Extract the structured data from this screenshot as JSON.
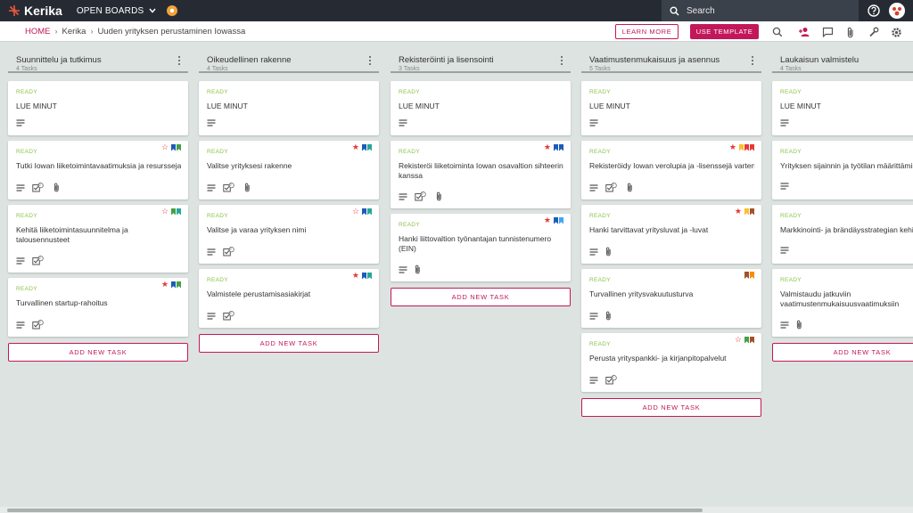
{
  "app": {
    "logo_text": "Kerika",
    "open_boards_label": "OPEN BOARDS",
    "search_placeholder": "Search"
  },
  "breadcrumb": {
    "home": "HOME",
    "org": "Kerika",
    "board": "Uuden yrityksen perustaminen Iowassa"
  },
  "toolbar": {
    "learn_more": "LEARN MORE",
    "use_template": "USE TEMPLATE",
    "icons": [
      "search-icon",
      "add-person-icon",
      "chat-icon",
      "attachment-icon",
      "tools-icon",
      "settings-icon"
    ]
  },
  "colors": {
    "accent": "#c2185b",
    "ready": "#8bc34a",
    "topbar": "#262b33",
    "background": "#dde3e1",
    "star_red": "#e53935",
    "star_outline": "#e53935",
    "bm_blue": "#1e5bb8",
    "bm_green": "#43a047",
    "bm_teal": "#26a69a",
    "bm_lightblue": "#42a5f5",
    "bm_yellow": "#fbc02d",
    "bm_orange": "#fb8c00",
    "bm_red": "#e53935",
    "bm_brown": "#a0522d"
  },
  "add_task_label": "ADD NEW TASK",
  "columns": [
    {
      "title": "Suunnittelu ja tutkimus",
      "count": "4 Tasks",
      "cards": [
        {
          "status": "READY",
          "title": "LUE MINUT",
          "flags": null,
          "icons": [
            "description"
          ]
        },
        {
          "status": "READY",
          "title": "Tutki Iowan liiketoimintavaatimuksia ja resursseja",
          "flags": {
            "star": "outline",
            "bookmarks": [
              "blue",
              "green"
            ]
          },
          "icons": [
            "description",
            "checklist",
            "attachment"
          ],
          "checklist_count": "0"
        },
        {
          "status": "READY",
          "title": "Kehitä liiketoimintasuunnitelma ja talousennusteet",
          "flags": {
            "star": "outline",
            "bookmarks": [
              "green",
              "teal"
            ]
          },
          "icons": [
            "description",
            "checklist"
          ],
          "checklist_count": "0"
        },
        {
          "status": "READY",
          "title": "Turvallinen startup-rahoitus",
          "flags": {
            "star": "filled",
            "bookmarks": [
              "blue",
              "green"
            ]
          },
          "icons": [
            "description",
            "checklist"
          ],
          "checklist_count": "0"
        }
      ]
    },
    {
      "title": "Oikeudellinen rakenne",
      "count": "4 Tasks",
      "cards": [
        {
          "status": "READY",
          "title": "LUE MINUT",
          "flags": null,
          "icons": [
            "description"
          ]
        },
        {
          "status": "READY",
          "title": "Valitse yrityksesi rakenne",
          "flags": {
            "star": "filled",
            "bookmarks": [
              "blue",
              "teal"
            ]
          },
          "icons": [
            "description",
            "checklist",
            "attachment"
          ],
          "checklist_count": "0"
        },
        {
          "status": "READY",
          "title": "Valitse ja varaa yrityksen nimi",
          "flags": {
            "star": "outline",
            "bookmarks": [
              "blue",
              "teal"
            ]
          },
          "icons": [
            "description",
            "checklist"
          ],
          "checklist_count": "0"
        },
        {
          "status": "READY",
          "title": "Valmistele perustamisasiakirjat",
          "flags": {
            "star": "filled",
            "bookmarks": [
              "blue",
              "teal"
            ]
          },
          "icons": [
            "description",
            "checklist"
          ],
          "checklist_count": "0"
        }
      ]
    },
    {
      "title": "Rekisteröinti ja lisensointi",
      "count": "3 Tasks",
      "cards": [
        {
          "status": "READY",
          "title": "LUE MINUT",
          "flags": null,
          "icons": [
            "description"
          ]
        },
        {
          "status": "READY",
          "title": "Rekisteröi liiketoiminta Iowan osavaltion sihteerin kanssa",
          "flags": {
            "star": "filled",
            "bookmarks": [
              "blue",
              "blue"
            ]
          },
          "icons": [
            "description",
            "checklist",
            "attachment"
          ],
          "checklist_count": "0"
        },
        {
          "status": "READY",
          "title": "Hanki liittovaltion työnantajan tunnistenumero (EIN)",
          "flags": {
            "star": "filled",
            "bookmarks": [
              "blue",
              "lightblue"
            ]
          },
          "icons": [
            "description",
            "attachment"
          ]
        }
      ]
    },
    {
      "title": "Vaatimustenmukaisuus ja asennus",
      "count": "5 Tasks",
      "cards": [
        {
          "status": "READY",
          "title": "LUE MINUT",
          "flags": null,
          "icons": [
            "description"
          ]
        },
        {
          "status": "READY",
          "title": "Rekisteröidy Iowan verolupia ja -lisenssejä varten",
          "flags": {
            "star": "filled",
            "bookmarks": [
              "yellow",
              "red",
              "red"
            ]
          },
          "icons": [
            "description",
            "checklist",
            "attachment"
          ],
          "checklist_count": "0"
        },
        {
          "status": "READY",
          "title": "Hanki tarvittavat yritysluvat ja -luvat",
          "flags": {
            "star": "filled",
            "bookmarks": [
              "yellow",
              "brown"
            ]
          },
          "icons": [
            "description",
            "attachment"
          ]
        },
        {
          "status": "READY",
          "title": "Turvallinen yritysvakuutusturva",
          "flags": {
            "star": "none",
            "bookmarks": [
              "brown",
              "orange"
            ]
          },
          "icons": [
            "description",
            "attachment"
          ]
        },
        {
          "status": "READY",
          "title": "Perusta yrityspankki- ja kirjanpitopalvelut",
          "flags": {
            "star": "outline",
            "bookmarks": [
              "green",
              "brown"
            ]
          },
          "icons": [
            "description",
            "checklist"
          ],
          "checklist_count": "0"
        }
      ]
    },
    {
      "title": "Laukaisun valmistelu",
      "count": "4 Tasks",
      "cards": [
        {
          "status": "READY",
          "title": "LUE MINUT",
          "flags": null,
          "icons": [
            "description"
          ]
        },
        {
          "status": "READY",
          "title": "Yrityksen sijainnin ja työtilan määrittäminen",
          "flags": null,
          "icons": [
            "description"
          ]
        },
        {
          "status": "READY",
          "title": "Markkinointi- ja brändäysstrategian kehittäminen",
          "flags": null,
          "icons": [
            "description"
          ]
        },
        {
          "status": "READY",
          "title": "Valmistaudu jatkuviin vaatimustenmukaisuusvaatimuksiin",
          "flags": null,
          "icons": [
            "description",
            "attachment"
          ]
        }
      ]
    }
  ]
}
